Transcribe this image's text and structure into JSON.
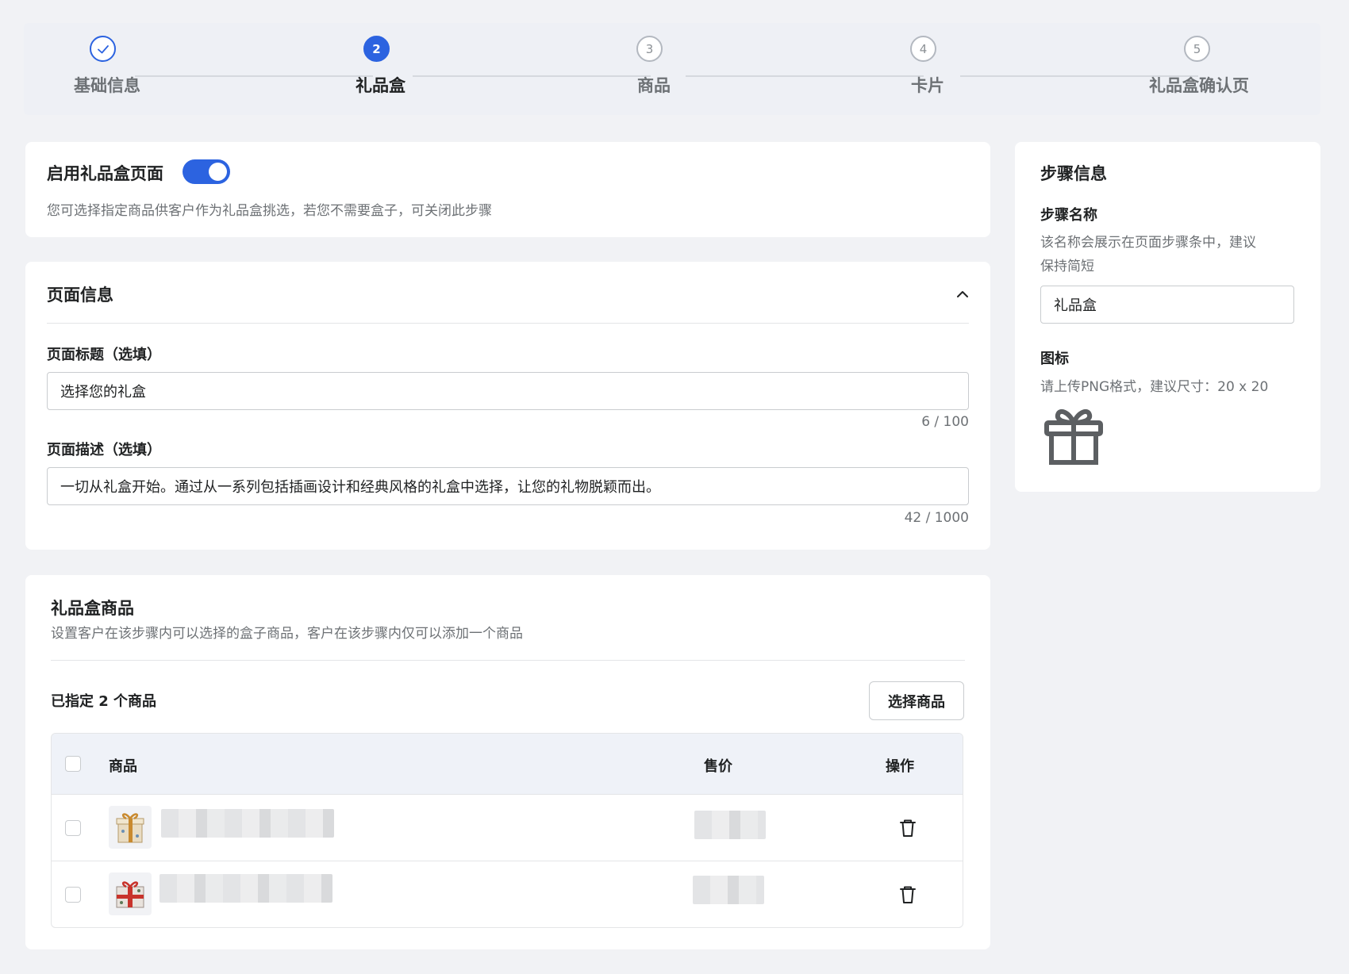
{
  "stepper": {
    "steps": [
      {
        "label": "基础信息",
        "number": "",
        "state": "done"
      },
      {
        "label": "礼品盒",
        "number": "2",
        "state": "active"
      },
      {
        "label": "商品",
        "number": "3",
        "state": "pending"
      },
      {
        "label": "卡片",
        "number": "4",
        "state": "pending"
      },
      {
        "label": "礼品盒确认页",
        "number": "5",
        "state": "pending"
      }
    ]
  },
  "enable_card": {
    "title": "启用礼品盒页面",
    "enabled": true,
    "description": "您可选择指定商品供客户作为礼品盒挑选，若您不需要盒子，可关闭此步骤"
  },
  "page_info": {
    "title": "页面信息",
    "page_title_label": "页面标题（选填）",
    "page_title_value": "选择您的礼盒",
    "page_title_counter": "6 / 100",
    "page_desc_label": "页面描述（选填）",
    "page_desc_value": "一切从礼盒开始。通过从一系列包括插画设计和经典风格的礼盒中选择，让您的礼物脱颖而出。",
    "page_desc_counter": "42 / 1000"
  },
  "gift_products": {
    "title": "礼品盒商品",
    "description": "设置客户在该步骤内可以选择的盒子商品，客户在该步骤内仅可以添加一个商品",
    "selected_count_text": "已指定 2 个商品",
    "select_button": "选择商品",
    "columns": {
      "product": "商品",
      "price": "售价",
      "action": "操作"
    }
  },
  "step_info": {
    "title": "步骤信息",
    "name_label": "步骤名称",
    "name_help_line1": "该名称会展示在页面步骤条中，建议",
    "name_help_line2": "保持简短",
    "name_value": "礼品盒",
    "icon_label": "图标",
    "icon_help": "请上传PNG格式，建议尺寸：20 x 20"
  },
  "colors": {
    "primary": "#2c63e0",
    "background": "#f1f2f5",
    "muted_text": "#6d7175"
  }
}
